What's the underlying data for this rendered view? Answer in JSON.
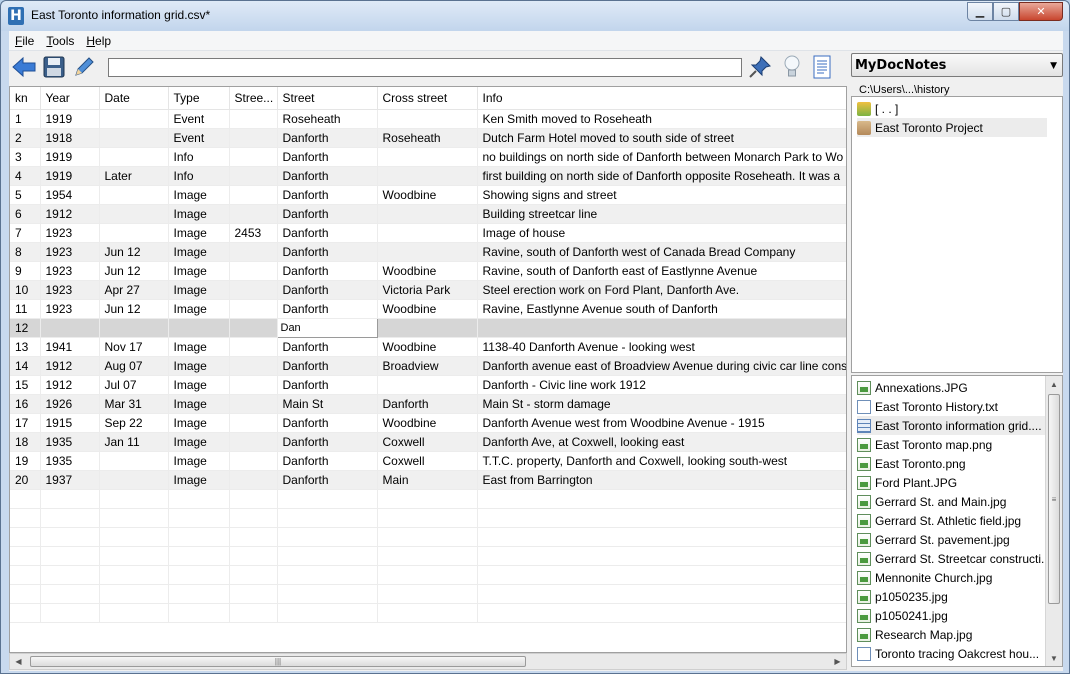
{
  "window": {
    "title": "East Toronto information grid.csv*",
    "app_icon_letter": "H"
  },
  "menu": [
    {
      "label": "File",
      "accel": "F",
      "rest": "ile"
    },
    {
      "label": "Tools",
      "accel": "T",
      "rest": "ools"
    },
    {
      "label": "Help",
      "accel": "H",
      "rest": "elp"
    }
  ],
  "toolbar": {
    "path_value": "",
    "icons": [
      "back-arrow-icon",
      "save-disk-icon",
      "pencil-edit-icon",
      "pushpin-icon",
      "lightbulb-icon",
      "notes-page-icon"
    ]
  },
  "grid": {
    "columns": [
      "kn",
      "Year",
      "Date",
      "Type",
      "Stree...",
      "Street",
      "Cross street",
      "Info"
    ],
    "rows": [
      [
        "1",
        "1919",
        "",
        "Event",
        "",
        "Roseheath",
        "",
        "Ken Smith moved to Roseheath"
      ],
      [
        "2",
        "1918",
        "",
        "Event",
        "",
        "Danforth",
        "Roseheath",
        "Dutch Farm Hotel moved to south side of street"
      ],
      [
        "3",
        "1919",
        "",
        "Info",
        "",
        "Danforth",
        "",
        "no buildings on north side of Danforth between Monarch Park to Wo"
      ],
      [
        "4",
        "1919",
        "Later",
        "Info",
        "",
        "Danforth",
        "",
        "first building on north side of Danforth opposite Roseheath.  It was a"
      ],
      [
        "5",
        "1954",
        "",
        "Image",
        "",
        "Danforth",
        "Woodbine",
        "Showing signs and street"
      ],
      [
        "6",
        "1912",
        "",
        "Image",
        "",
        "Danforth",
        "",
        "Building streetcar line"
      ],
      [
        "7",
        "1923",
        "",
        "Image",
        "2453",
        "Danforth",
        "",
        "Image of house"
      ],
      [
        "8",
        "1923",
        "Jun 12",
        "Image",
        "",
        "Danforth",
        "",
        "Ravine, south of Danforth west of Canada Bread Company"
      ],
      [
        "9",
        "1923",
        "Jun 12",
        "Image",
        "",
        "Danforth",
        "Woodbine",
        "Ravine, south of Danforth east of Eastlynne Avenue"
      ],
      [
        "10",
        "1923",
        "Apr 27",
        "Image",
        "",
        "Danforth",
        "Victoria Park",
        "Steel erection work on Ford Plant, Danforth Ave."
      ],
      [
        "11",
        "1923",
        "Jun 12",
        "Image",
        "",
        "Danforth",
        "Woodbine",
        "Ravine, Eastlynne Avenue south of Danforth"
      ],
      [
        "12",
        "",
        "",
        "",
        "",
        "Dan",
        "",
        ""
      ],
      [
        "13",
        "1941",
        "Nov 17",
        "Image",
        "",
        "Danforth",
        "Woodbine",
        "1138-40 Danforth Avenue - looking west"
      ],
      [
        "14",
        "1912",
        "Aug 07",
        "Image",
        "",
        "Danforth",
        "Broadview",
        "Danforth avenue east of Broadview Avenue during civic car line const"
      ],
      [
        "15",
        "1912",
        "Jul 07",
        "Image",
        "",
        "Danforth",
        "",
        "Danforth - Civic line work 1912"
      ],
      [
        "16",
        "1926",
        "Mar 31",
        "Image",
        "",
        "Main St",
        "Danforth",
        "Main St - storm damage"
      ],
      [
        "17",
        "1915",
        "Sep 22",
        "Image",
        "",
        "Danforth",
        "Woodbine",
        "Danforth Avenue west from Woodbine Avenue - 1915"
      ],
      [
        "18",
        "1935",
        "Jan 11",
        "Image",
        "",
        "Danforth",
        "Coxwell",
        "Danforth Ave, at Coxwell, looking east"
      ],
      [
        "19",
        "1935",
        "",
        "Image",
        "",
        "Danforth",
        "Coxwell",
        "T.T.C. property, Danforth and Coxwell, looking south-west"
      ],
      [
        "20",
        "1937",
        "",
        "Image",
        "",
        "Danforth",
        "Main",
        "East from Barrington"
      ]
    ],
    "selected_row": "12",
    "editing_cell_value": "Dan"
  },
  "right_panel": {
    "doc_selector": "MyDocNotes",
    "directory": "C:\\Users\\...\\history",
    "folders": [
      {
        "name": "[ . . ]",
        "icon": "parent-folder-icon"
      },
      {
        "name": "East Toronto Project",
        "icon": "folder-icon"
      }
    ],
    "files": [
      {
        "name": "Annexations.JPG",
        "icon": "image-file-icon"
      },
      {
        "name": "East Toronto History.txt",
        "icon": "text-file-icon"
      },
      {
        "name": "East Toronto information grid....",
        "icon": "grid-file-icon"
      },
      {
        "name": "East Toronto map.png",
        "icon": "image-file-icon"
      },
      {
        "name": "East Toronto.png",
        "icon": "image-file-icon"
      },
      {
        "name": "Ford Plant.JPG",
        "icon": "image-file-icon"
      },
      {
        "name": "Gerrard St. and Main.jpg",
        "icon": "image-file-icon"
      },
      {
        "name": "Gerrard St. Athletic field.jpg",
        "icon": "image-file-icon"
      },
      {
        "name": "Gerrard St. pavement.jpg",
        "icon": "image-file-icon"
      },
      {
        "name": "Gerrard St. Streetcar constructi...",
        "icon": "image-file-icon"
      },
      {
        "name": "Mennonite Church.jpg",
        "icon": "image-file-icon"
      },
      {
        "name": "p1050235.jpg",
        "icon": "image-file-icon"
      },
      {
        "name": "p1050241.jpg",
        "icon": "image-file-icon"
      },
      {
        "name": "Research Map.jpg",
        "icon": "image-file-icon"
      },
      {
        "name": "Toronto tracing Oakcrest hou...",
        "icon": "text-file-icon"
      }
    ]
  }
}
